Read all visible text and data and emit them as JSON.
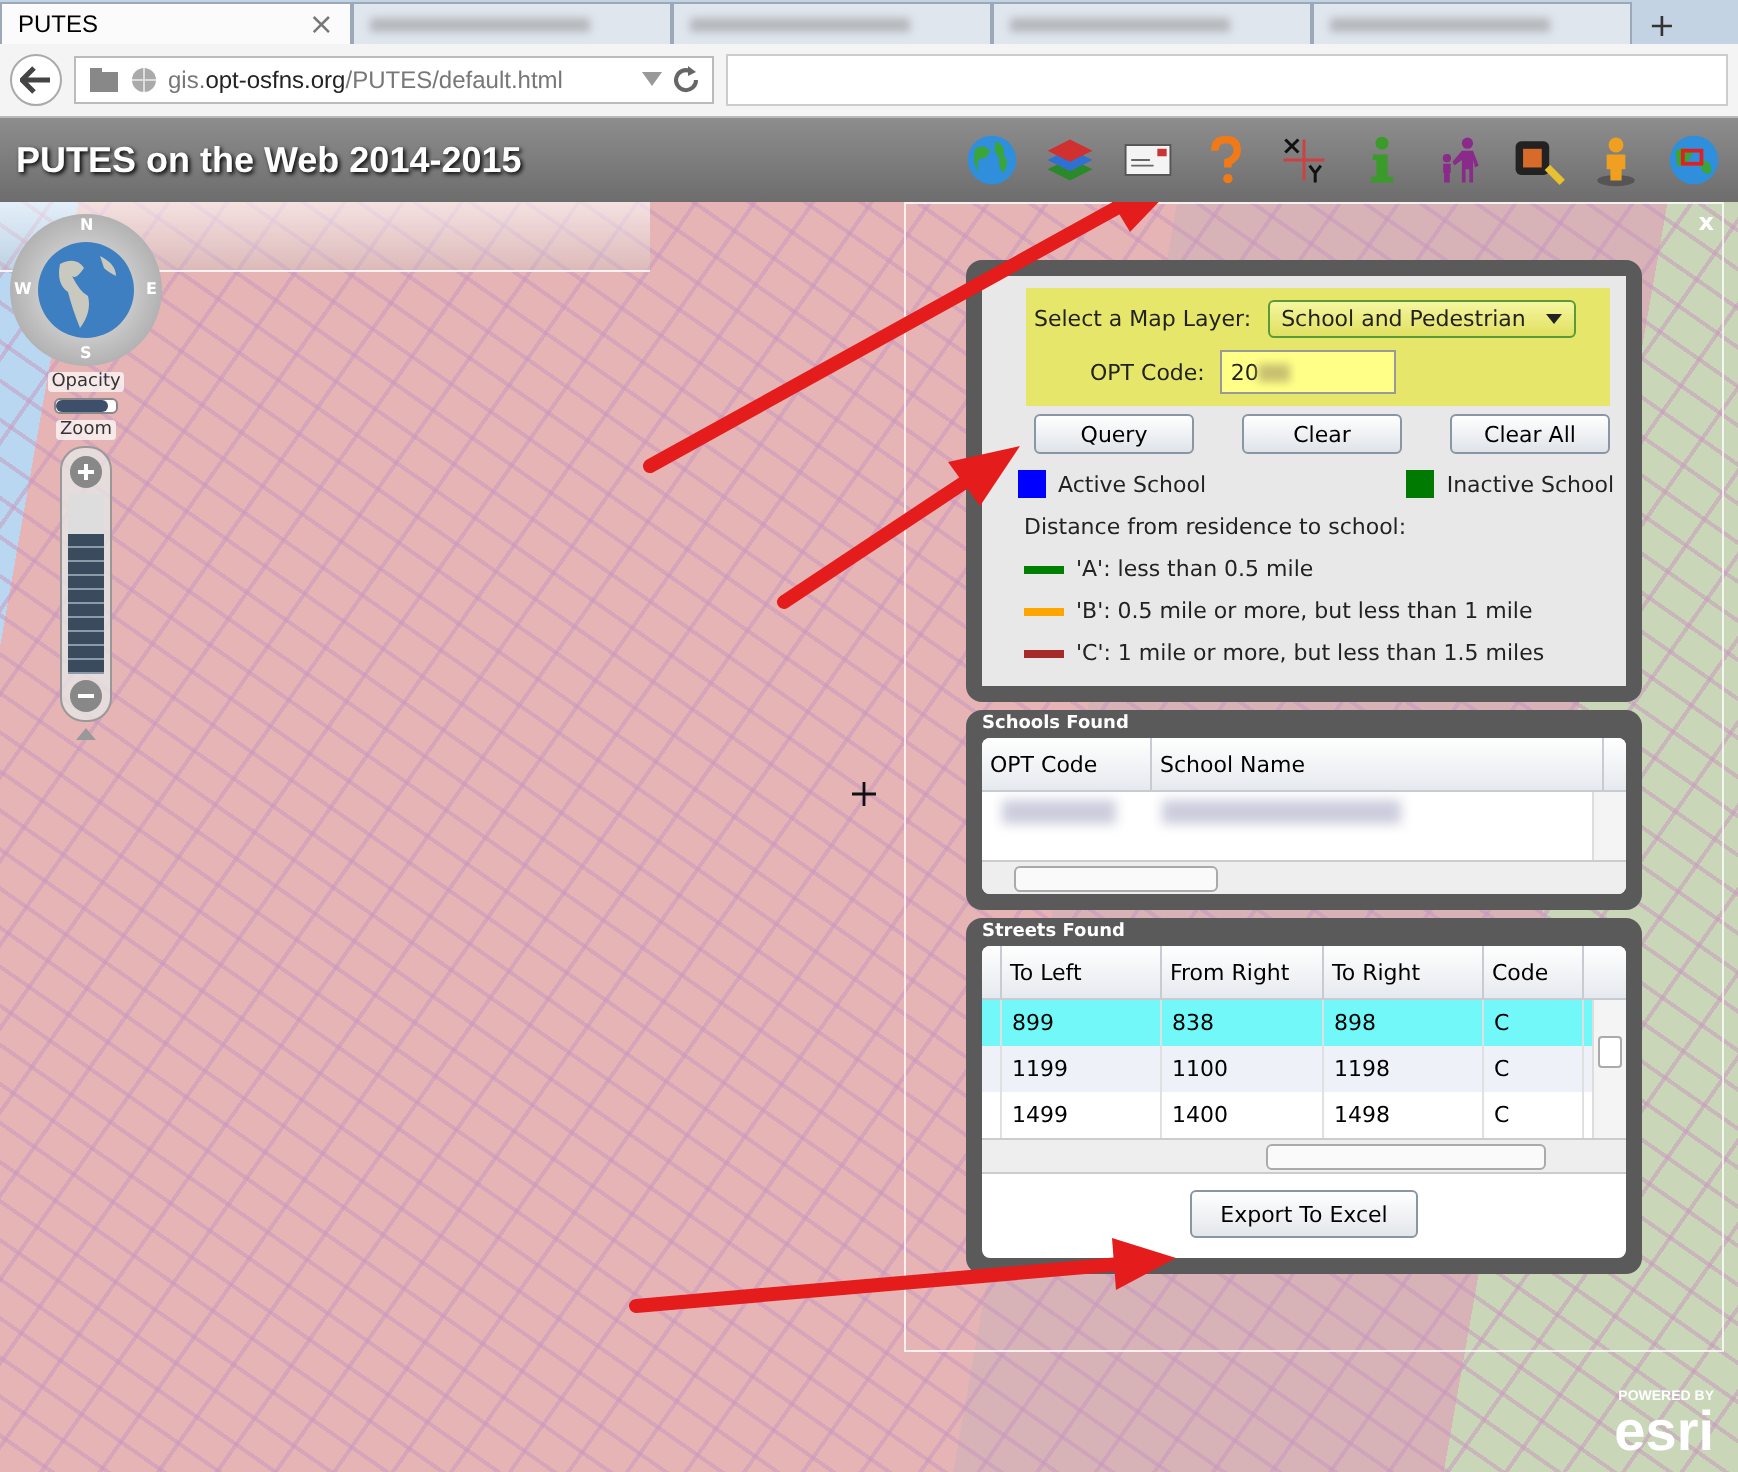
{
  "browser": {
    "tabs": [
      {
        "label": "PUTES",
        "selected": true
      }
    ],
    "close_tab": "×",
    "new_tab": "+",
    "url": {
      "plain_start": "gis.",
      "domain": "opt-osfns.org",
      "rest": "/PUTES/default.html"
    }
  },
  "app": {
    "title": "PUTES on the Web 2014-2015"
  },
  "map_nav": {
    "compass": {
      "n": "N",
      "w": "W",
      "e": "E",
      "s": "S"
    },
    "opacity_label": "Opacity",
    "opacity": {
      "level": 0.85
    },
    "zoom_label": "Zoom",
    "zoom": {
      "level": 0.78
    }
  },
  "panel": {
    "close": "x",
    "query": {
      "layer_label": "Select a Map Layer:",
      "layer_value": "School and Pedestrian",
      "code_label": "OPT Code:",
      "code_value": "20",
      "buttons": [
        "Query",
        "Clear",
        "Clear All"
      ],
      "legend": [
        {
          "label": "Active School",
          "color": "#0000ff"
        },
        {
          "label": "Inactive School",
          "color": "#007a00"
        }
      ],
      "distance_title": "Distance from residence to school:",
      "distance": [
        {
          "label": "'A': less than 0.5 mile",
          "color": "#008000"
        },
        {
          "label": "'B': 0.5 mile or more, but less than 1 mile",
          "color": "#ffa500"
        },
        {
          "label": "'C': 1 mile or more, but less than 1.5 miles",
          "color": "#a52a2a"
        }
      ]
    },
    "schools_found": {
      "title": "Schools Found",
      "columns": [
        "OPT Code",
        "School Name"
      ]
    },
    "streets_found": {
      "title": "Streets Found",
      "columns": [
        "To Left",
        "From Right",
        "To Right",
        "Code"
      ],
      "rows": [
        {
          "cells": [
            "899",
            "838",
            "898",
            "C"
          ],
          "selected": true
        },
        {
          "cells": [
            "1199",
            "1100",
            "1198",
            "C"
          ],
          "selected": false
        },
        {
          "cells": [
            "1499",
            "1400",
            "1498",
            "C"
          ],
          "selected": false
        }
      ],
      "export_button": "Export To Excel"
    }
  },
  "esri": {
    "powered_by": "POWERED BY",
    "brand": "esri"
  }
}
